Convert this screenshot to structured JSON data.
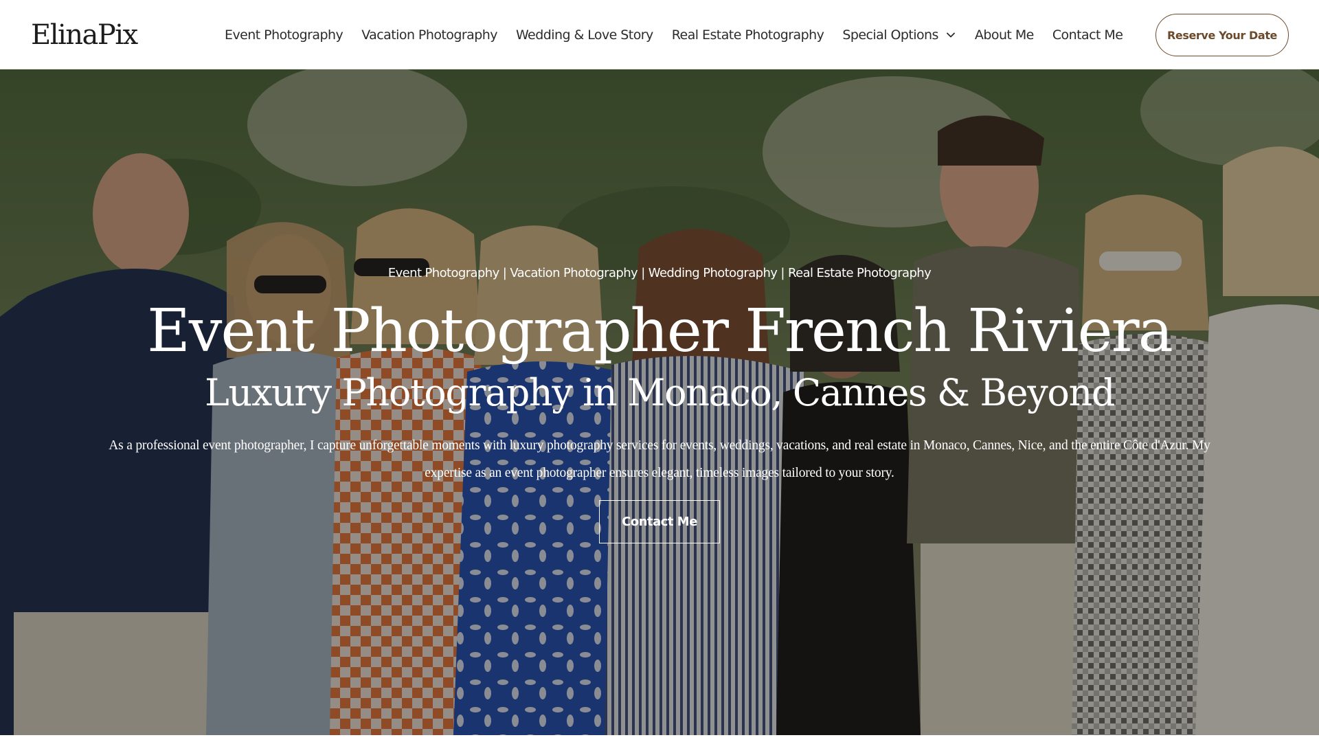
{
  "header": {
    "logo": "ElinaPix",
    "nav": [
      {
        "label": "Event Photography"
      },
      {
        "label": "Vacation Photography"
      },
      {
        "label": "Wedding & Love Story"
      },
      {
        "label": "Real Estate Photography"
      },
      {
        "label": "Special Options",
        "icon": "chevron-down-icon"
      },
      {
        "label": "About Me"
      },
      {
        "label": "Contact Me"
      }
    ],
    "cta_label": "Reserve Your Date"
  },
  "hero": {
    "services_line": "Event Photography | Vacation Photography | Wedding Photography | Real Estate Photography",
    "title": "Event Photographer French Riviera",
    "subtitle": "Luxury Photography in Monaco, Cannes & Beyond",
    "description": "As a professional event photographer, I capture unforgettable moments with luxury photography services for events, weddings, vacations, and real estate in Monaco, Cannes, Nice, and the entire Côte d'Azur. My expertise as an event photographer ensures elegant, timeless images tailored to your story.",
    "button_label": "Contact Me"
  },
  "colors": {
    "accent": "#6b4a2b",
    "text_dark": "#2b2b2b",
    "overlay": "#14100c"
  }
}
